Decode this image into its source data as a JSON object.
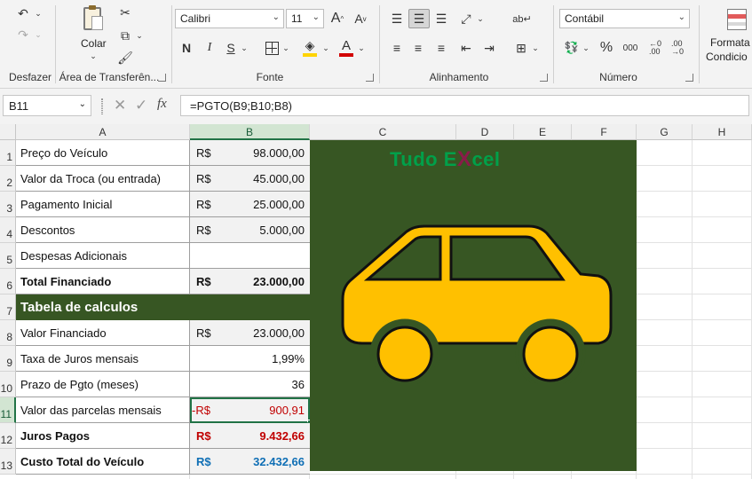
{
  "ribbon": {
    "groups": {
      "undo": "Desfazer",
      "clipboard": "Área de Transferên...",
      "font": "Fonte",
      "alignment": "Alinhamento",
      "number": "Número"
    },
    "paste_label": "Colar",
    "font_name": "Calibri",
    "font_size": "11",
    "number_format": "Contábil",
    "conditional_format_label_1": "Formata",
    "conditional_format_label_2": "Condicio",
    "bold": "N",
    "italic": "I",
    "underline": "S",
    "percent": "%",
    "thousands": "000",
    "grow_font": "A",
    "shrink_font": "A",
    "font_color_letter": "A",
    "font_color": "#d20000",
    "fill_color": "#ffd400",
    "accent": "#217346"
  },
  "formula_bar": {
    "name_box": "B11",
    "fx": "fx",
    "formula": "=PGTO(B9;B10;B8)"
  },
  "columns": [
    "A",
    "B",
    "C",
    "D",
    "E",
    "F",
    "G",
    "H"
  ],
  "rows": [
    "1",
    "2",
    "3",
    "4",
    "5",
    "6",
    "7",
    "8",
    "9",
    "10",
    "11",
    "12",
    "13"
  ],
  "cells": {
    "r1": {
      "a": "Preço do Veículo",
      "cur": "R$",
      "val": "98.000,00"
    },
    "r2": {
      "a": "Valor da Troca (ou entrada)",
      "cur": "R$",
      "val": "45.000,00"
    },
    "r3": {
      "a": "Pagamento Inicial",
      "cur": "R$",
      "val": "25.000,00"
    },
    "r4": {
      "a": "Descontos",
      "cur": "R$",
      "val": "5.000,00"
    },
    "r5": {
      "a": "Despesas Adicionais",
      "cur": "",
      "val": ""
    },
    "r6": {
      "a": "Total Financiado",
      "cur": "R$",
      "val": "23.000,00"
    },
    "r7": {
      "a": "Tabela de calculos"
    },
    "r8": {
      "a": "Valor Financiado",
      "cur": "R$",
      "val": "23.000,00"
    },
    "r9": {
      "a": "Taxa de Juros mensais",
      "val": "1,99%"
    },
    "r10": {
      "a": "Prazo de Pgto (meses)",
      "val": "36"
    },
    "r11": {
      "a": "Valor das parcelas mensais",
      "cur": "-R$",
      "val": "900,91"
    },
    "r12": {
      "a": "Juros Pagos",
      "cur": "R$",
      "val": "9.432,66"
    },
    "r13": {
      "a": "Custo Total do Veículo",
      "cur": "R$",
      "val": "32.432,66"
    }
  },
  "logo": {
    "part1": "Tudo E",
    "x": "X",
    "part2": "cel"
  },
  "colors": {
    "panel_green": "#375623",
    "car_yellow": "#ffc000",
    "negative_red": "#c00000",
    "total_blue": "#0f6fb5",
    "logo_green": "#00a04a",
    "logo_x": "#8b1b4a"
  }
}
